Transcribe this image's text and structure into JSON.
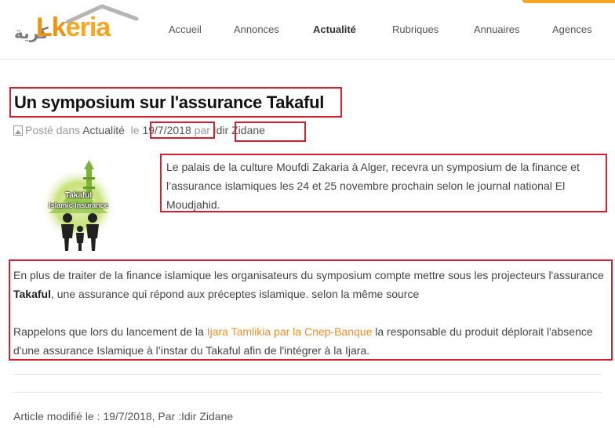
{
  "header": {
    "logo_text_main": "Lk",
    "logo_text_rest": "eria",
    "logo_arabic": "كرية",
    "nav": [
      {
        "label": "Accueil",
        "active": false
      },
      {
        "label": "Annonces",
        "active": false
      },
      {
        "label": "Actualité",
        "active": true
      },
      {
        "label": "Rubriques",
        "active": false
      },
      {
        "label": "Annuaires",
        "active": false
      },
      {
        "label": "Agences",
        "active": false
      }
    ]
  },
  "article": {
    "title": "Un symposium sur l'assurance Takaful",
    "meta": {
      "posted_in": "Posté dans",
      "category": "Actualité",
      "date_prefix": "le",
      "date": "19/7/2018",
      "author_prefix": "par",
      "author": "Idir Zidane"
    },
    "image": {
      "icon": "takaful-islamic-insurance-illustration",
      "caption_line1": "Takaful",
      "caption_line2": "Islamic Insurance"
    },
    "lead": "Le palais de la culture Moufdi Zakaria à Alger, recevra un symposium de la finance et l’assurance islamiques les 24 et 25 novembre prochain selon le journal national El Moudjahid.",
    "para1_before": "En plus de traiter de la finance islamique les organisateurs du symposium compte mettre sous les projecteurs l'assurance ",
    "para1_bold": "Takaful",
    "para1_after": ", une assurance qui répond aux préceptes islamique. selon la même source",
    "para2_before": "Rappelons  que lors du lancement de la ",
    "para2_link": "Ijara Tamlikia par la Cnep-Banque",
    "para2_after": " la responsable du produit déplorait l'absence d'une assurance Islamique à l’instar du Takaful afin de l'intégrer à la Ijara.",
    "footer": "Article modifié le : 19/7/2018, Par :Idir Zidane"
  },
  "colors": {
    "accent": "#f5a623",
    "annotation_box": "#d62030",
    "link": "#e8922c"
  }
}
